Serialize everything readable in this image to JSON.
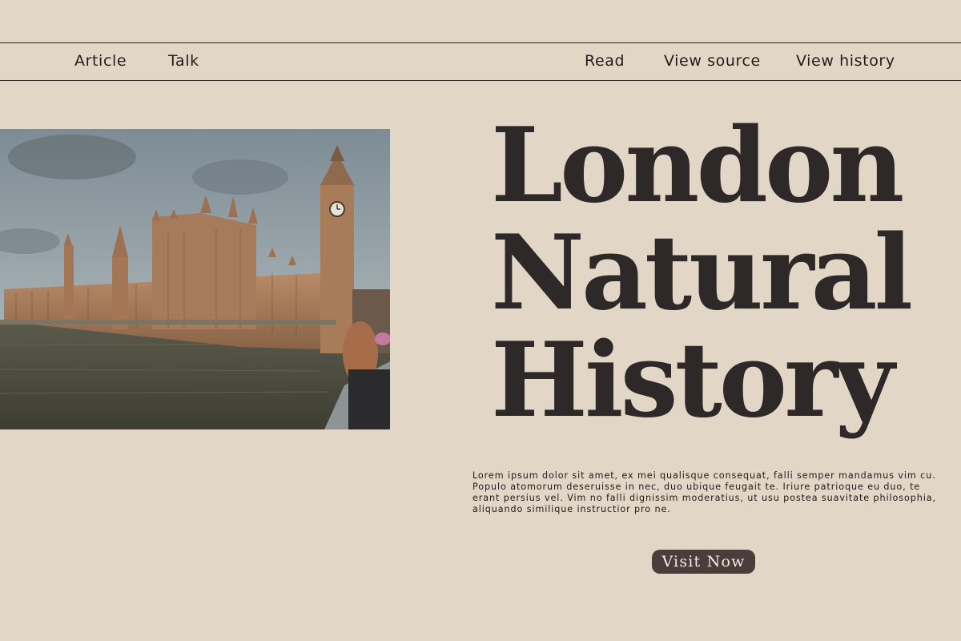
{
  "nav": {
    "left": [
      {
        "label": "Article"
      },
      {
        "label": "Talk"
      }
    ],
    "right": [
      {
        "label": "Read"
      },
      {
        "label": "View source"
      },
      {
        "label": "View history"
      }
    ]
  },
  "hero": {
    "title_lines": [
      "London",
      "Natural",
      "History"
    ],
    "body": "Lorem ipsum dolor sit amet, ex mei qualisque consequat, falli semper mandamus vim cu. Populo atomorum deseruisse in nec, duo ubique feugait te. Iriure patrioque eu duo, te erant persius vel. Vim no falli dignissim moderatius, ut usu postea suavitate philosophia, aliquando similique instructior pro ne.",
    "cta_label": "Visit Now"
  },
  "colors": {
    "background": "#e2d6c6",
    "text": "#2f2828",
    "button": "#4a3d3c",
    "button_text": "#f3ece4"
  }
}
